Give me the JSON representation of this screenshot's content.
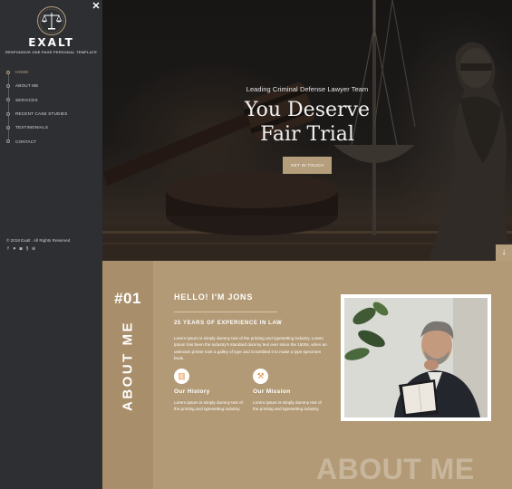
{
  "brand": {
    "name": "EXALT",
    "tagline": "RESPONSIVE ONE PAGE PERSONAL TEMPLATE",
    "emblem_icon": "scales-icon"
  },
  "sidebar": {
    "nav": [
      {
        "label": "HOME",
        "active": true
      },
      {
        "label": "ABOUT ME",
        "active": false
      },
      {
        "label": "SERVICES",
        "active": false
      },
      {
        "label": "RECENT CASE STUDIES",
        "active": false
      },
      {
        "label": "TESTIMONIALS",
        "active": false
      },
      {
        "label": "CONTACT",
        "active": false
      }
    ],
    "copyright": "© 2018 Exalt . All Rights Reserved",
    "social_icons": [
      "facebook-icon",
      "twitter-icon",
      "instagram-icon",
      "skype-icon",
      "dribbble-icon"
    ]
  },
  "close_icon": "close-icon",
  "hero": {
    "subtitle": "Leading Criminal Defense Lawyer Team",
    "title_line1": "You Deserve",
    "title_line2": "Fair Trial",
    "button_label": "GET IN TOUCH",
    "scroll_icon": "arrow-down-icon"
  },
  "about": {
    "number": "#01",
    "vertical_label": "ABOUT ME",
    "heading": "HELLO! I'M JONS",
    "experience": "25 YEARS OF EXPERIENCE IN LAW",
    "description": "Lorem Ipsum is simply dummy text of the printing and typesetting industry. Lorem Ipsum has been the industry's standard dummy text ever since the 1500s, when an unknown printer took a galley of type and scrambled it to make a type specimen book.",
    "features": [
      {
        "title": "Our History",
        "text": "Lorem Ipsum is simply dummy text of the printing and typesetting industry.",
        "icon": "history-icon"
      },
      {
        "title": "Our Mission",
        "text": "Lorem Ipsum is simply dummy text of the printing and typesetting industry.",
        "icon": "gavel-icon"
      }
    ],
    "background_word": "ABOUT ME"
  },
  "colors": {
    "sidebar_bg": "#2e2f33",
    "accent_gold": "#b59e7b",
    "about_bg": "#b39a76",
    "about_strip": "#a88e6a",
    "feature_icon_orange": "#e39447"
  }
}
